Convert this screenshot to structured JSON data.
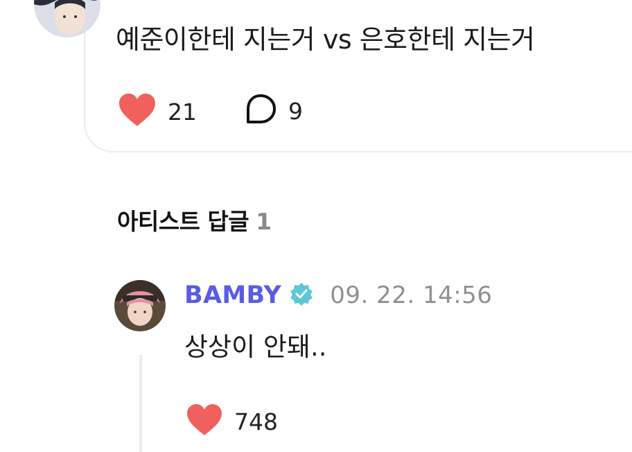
{
  "post": {
    "text": "예준이한테 지는거 vs 은호한테 지는거",
    "likes": "21",
    "comments": "9"
  },
  "section": {
    "title": "아티스트 답글",
    "count": "1"
  },
  "reply": {
    "author": "BAMBY",
    "timestamp": "09. 22. 14:56",
    "text": "상상이 안돼..",
    "likes": "748"
  },
  "colors": {
    "heart": "#f0605d",
    "author": "#5b5ce2",
    "verified": "#5ac8d8",
    "muted": "#8f8f8f"
  },
  "icons": [
    "heart-icon",
    "comment-bubble-icon",
    "verified-badge-icon"
  ]
}
